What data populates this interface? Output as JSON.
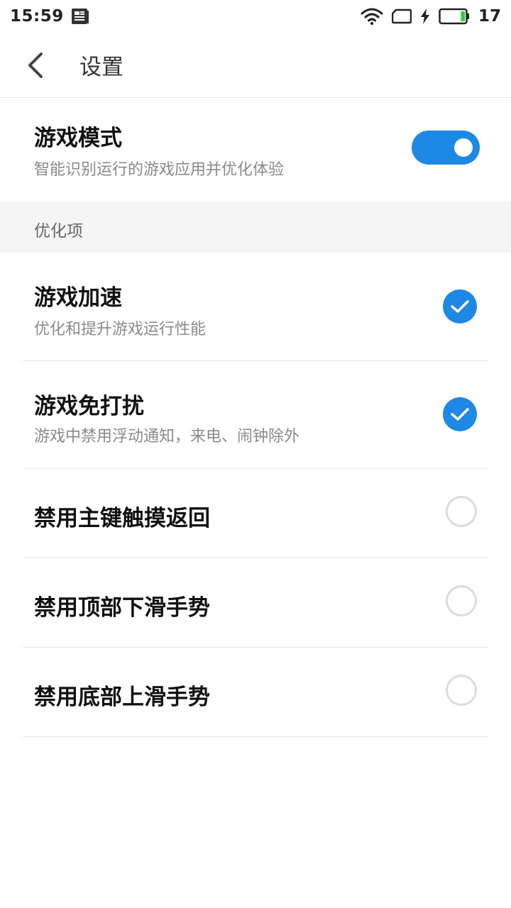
{
  "status_bar": {
    "time": "15:59",
    "battery_level": "17",
    "battery_fill_fraction": 0.17,
    "accent_battery": "#2ecc40"
  },
  "app_bar": {
    "title": "设置"
  },
  "game_mode": {
    "title": "游戏模式",
    "subtitle": "智能识别运行的游戏应用并优化体验",
    "enabled": true
  },
  "section": {
    "title": "优化项"
  },
  "options": [
    {
      "title": "游戏加速",
      "subtitle": "优化和提升游戏运行性能",
      "checked": true
    },
    {
      "title": "游戏免打扰",
      "subtitle": "游戏中禁用浮动通知，来电、闹钟除外",
      "checked": true
    },
    {
      "title": "禁用主键触摸返回",
      "checked": false
    },
    {
      "title": "禁用顶部下滑手势",
      "checked": false
    },
    {
      "title": "禁用底部上滑手势",
      "checked": false
    }
  ],
  "colors": {
    "accent": "#1e88e5",
    "section_bg": "#f5f5f5"
  }
}
